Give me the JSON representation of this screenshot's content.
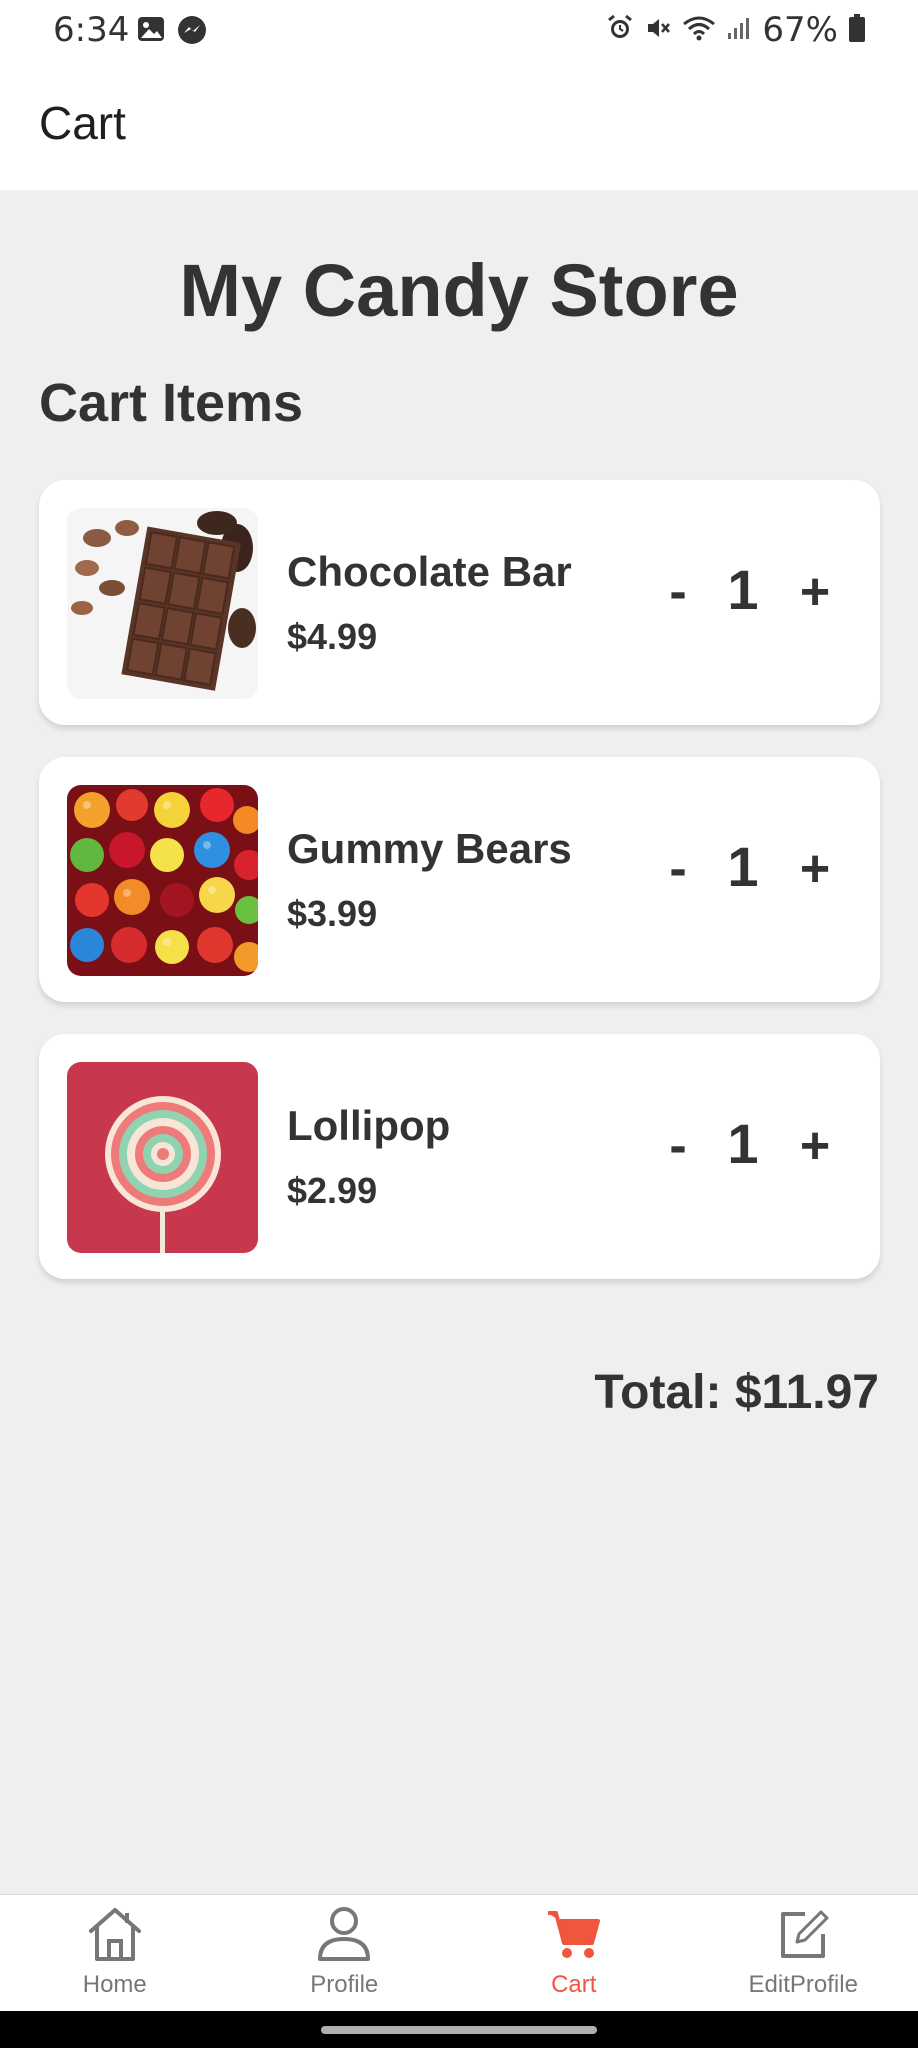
{
  "status_bar": {
    "time": "6:34",
    "battery": "67%",
    "left_icons": [
      "image-icon",
      "messenger-icon"
    ],
    "right_icons": [
      "alarm-icon",
      "mute-icon",
      "wifi-icon",
      "signal-icon",
      "battery-icon"
    ]
  },
  "header": {
    "title": "Cart"
  },
  "main": {
    "store_title": "My Candy Store",
    "section_title": "Cart Items",
    "items": [
      {
        "name": "Chocolate Bar",
        "price": "$4.99",
        "quantity": "1",
        "minus": "-",
        "plus": "+",
        "image": "chocolate-bar-image"
      },
      {
        "name": "Gummy Bears",
        "price": "$3.99",
        "quantity": "1",
        "minus": "-",
        "plus": "+",
        "image": "gummy-bears-image"
      },
      {
        "name": "Lollipop",
        "price": "$2.99",
        "quantity": "1",
        "minus": "-",
        "plus": "+",
        "image": "lollipop-image"
      }
    ],
    "total": "Total: $11.97"
  },
  "bottom_nav": {
    "items": [
      {
        "label": "Home",
        "icon": "home-icon",
        "active": false
      },
      {
        "label": "Profile",
        "icon": "profile-icon",
        "active": false
      },
      {
        "label": "Cart",
        "icon": "cart-icon",
        "active": true
      },
      {
        "label": "EditProfile",
        "icon": "edit-icon",
        "active": false
      }
    ]
  },
  "colors": {
    "accent": "#f0553d",
    "background": "#efefef",
    "card": "#ffffff",
    "text": "#333333"
  }
}
